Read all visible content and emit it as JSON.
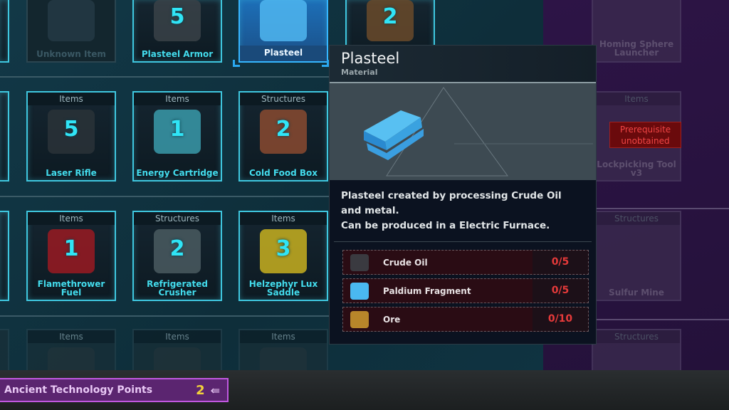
{
  "tree": {
    "rows": [
      {
        "cells": [
          {
            "category": "",
            "name": "Unknown Item",
            "count": "",
            "state": "locked",
            "color": "#243a44"
          },
          {
            "category": "",
            "name": "Plasteel Armor",
            "count": "5",
            "state": "active",
            "color": "#3a4248"
          },
          {
            "category": "",
            "name": "Plasteel",
            "count": "",
            "state": "selected",
            "color": "#4fb6f0"
          },
          {
            "category": "",
            "name": "",
            "count": "2",
            "state": "active",
            "color": "#6a4a2a"
          }
        ]
      },
      {
        "cells": [
          {
            "category": "Items",
            "name": "Laser Rifle",
            "count": "5",
            "state": "active",
            "color": "#2a3238"
          },
          {
            "category": "Items",
            "name": "Energy Cartridge",
            "count": "1",
            "state": "active",
            "color": "#3a9aaa"
          },
          {
            "category": "Structures",
            "name": "Cold Food Box",
            "count": "2",
            "state": "active",
            "color": "#8a4a30"
          }
        ]
      },
      {
        "cells": [
          {
            "category": "Items",
            "name": "Flamethrower Fuel",
            "count": "1",
            "state": "active",
            "color": "#9a1a22"
          },
          {
            "category": "Structures",
            "name": "Refrigerated Crusher",
            "count": "2",
            "state": "active",
            "color": "#4a5a60"
          },
          {
            "category": "Items",
            "name": "Helzephyr Lux Saddle",
            "count": "3",
            "state": "active",
            "color": "#c8b020"
          }
        ]
      },
      {
        "cells": [
          {
            "category": "Items",
            "name": "",
            "count": "",
            "state": "faded",
            "color": "#2a3438"
          },
          {
            "category": "Items",
            "name": "",
            "count": "",
            "state": "faded",
            "color": "#2a3438"
          },
          {
            "category": "Items",
            "name": "",
            "count": "",
            "state": "faded",
            "color": "#2a3438"
          }
        ]
      }
    ]
  },
  "next_page": {
    "cards": [
      {
        "category": "",
        "name": "Homing Sphere Launcher"
      },
      {
        "category": "Items",
        "name": "Lockpicking Tool v3"
      },
      {
        "category": "Structures",
        "name": "Sulfur Mine"
      },
      {
        "category": "Structures",
        "name": ""
      }
    ],
    "prerequisite_label": "Prerequisite unobtained"
  },
  "tooltip": {
    "title": "Plasteel",
    "subtitle": "Material",
    "description_1": "Plasteel created by processing Crude Oil and metal.",
    "description_2": "Can be produced in a Electric Furnace.",
    "materials": [
      {
        "name": "Crude Oil",
        "quantity": "0/5",
        "icon": "crude-oil-icon",
        "color": "#3a3a40"
      },
      {
        "name": "Paldium Fragment",
        "quantity": "0/5",
        "icon": "paldium-fragment-icon",
        "color": "#4ab8f0"
      },
      {
        "name": "Ore",
        "quantity": "0/10",
        "icon": "ore-icon",
        "color": "#b8862a"
      }
    ]
  },
  "tech_points": {
    "label": "Ancient Technology Points",
    "visible_label": "nt Technology Points",
    "count": "2",
    "icon": "ancient-tech-icon"
  },
  "colors": {
    "accent": "#3fc7df",
    "selected": "#1d6fb8",
    "missing": "#e63a3a",
    "tech_bar": "#5b2570"
  }
}
